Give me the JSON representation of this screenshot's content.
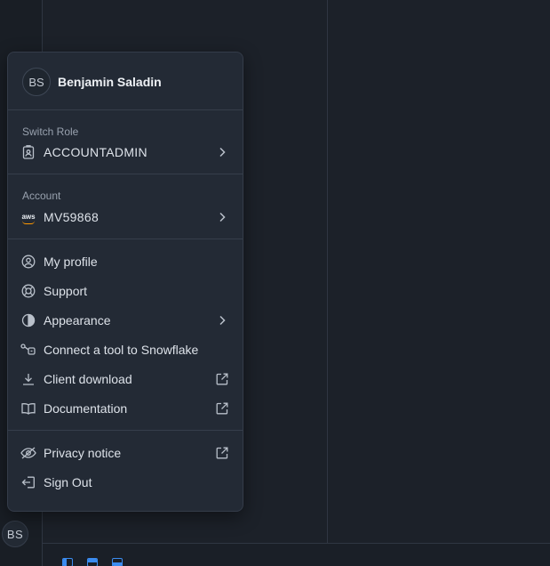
{
  "user": {
    "initials": "BS",
    "name": "Benjamin Saladin"
  },
  "role": {
    "section_label": "Switch Role",
    "value": "ACCOUNTADMIN",
    "icon": "id-badge-icon"
  },
  "account": {
    "section_label": "Account",
    "value": "MV59868",
    "icon": "aws-logo"
  },
  "menu_items": [
    {
      "label": "My profile",
      "icon": "user-circle-icon"
    },
    {
      "label": "Support",
      "icon": "lifebuoy-icon"
    },
    {
      "label": "Appearance",
      "icon": "half-circle-icon",
      "trailing": "chevron-right-icon"
    },
    {
      "label": "Connect a tool to Snowflake",
      "icon": "connect-icon"
    },
    {
      "label": "Client download",
      "icon": "download-icon",
      "trailing": "external-link-icon"
    },
    {
      "label": "Documentation",
      "icon": "book-icon",
      "trailing": "external-link-icon"
    }
  ],
  "footer_items": [
    {
      "label": "Privacy notice",
      "icon": "eye-off-icon",
      "trailing": "external-link-icon"
    },
    {
      "label": "Sign Out",
      "icon": "sign-out-icon"
    }
  ],
  "rail": {
    "avatar_initials": "BS"
  },
  "colors": {
    "background": "#1c2129",
    "menu": "#232a35",
    "accent": "#3b8cf0",
    "aws_orange": "#ff9900"
  }
}
